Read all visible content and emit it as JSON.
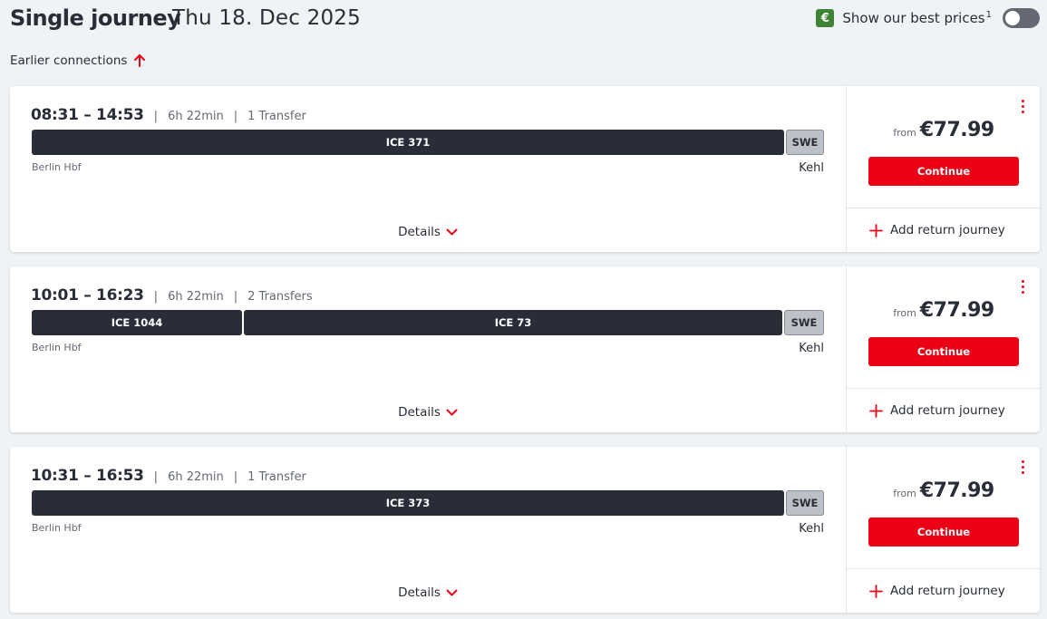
{
  "header": {
    "title": "Single journey",
    "date": "Thu 18. Dec 2025",
    "best_prices_badge": "€",
    "best_prices_label": "Show our best prices",
    "best_prices_sup": "1",
    "best_prices_enabled": false
  },
  "earlier_connections": "Earlier connections",
  "journeys": [
    {
      "times": "08:31 – 14:53",
      "duration": "6h 22min",
      "transfers": "1 Transfer",
      "segments": [
        "ICE 371",
        "SWE"
      ],
      "from_station": "Berlin Hbf",
      "to_station": "Kehl",
      "details_label": "Details",
      "price_prefix": "from",
      "price": "€77.99",
      "continue_label": "Continue",
      "add_return_label": "Add return journey"
    },
    {
      "times": "10:01 – 16:23",
      "duration": "6h 22min",
      "transfers": "2 Transfers",
      "segments": [
        "ICE 1044",
        "ICE 73",
        "SWE"
      ],
      "from_station": "Berlin Hbf",
      "to_station": "Kehl",
      "details_label": "Details",
      "price_prefix": "from",
      "price": "€77.99",
      "continue_label": "Continue",
      "add_return_label": "Add return journey"
    },
    {
      "times": "10:31 – 16:53",
      "duration": "6h 22min",
      "transfers": "1 Transfer",
      "segments": [
        "ICE 373",
        "SWE"
      ],
      "from_station": "Berlin Hbf",
      "to_station": "Kehl",
      "details_label": "Details",
      "price_prefix": "from",
      "price": "€77.99",
      "continue_label": "Continue",
      "add_return_label": "Add return journey"
    }
  ],
  "colors": {
    "accent_red": "#ec0016",
    "badge_green": "#408335",
    "train_bar": "#282d37",
    "bus_bar": "#bcc1c7"
  },
  "icons": {
    "earlier": "arrow-up-icon",
    "details": "chevron-down-icon",
    "add_return": "plus-icon",
    "menu": "more-vertical-icon"
  }
}
